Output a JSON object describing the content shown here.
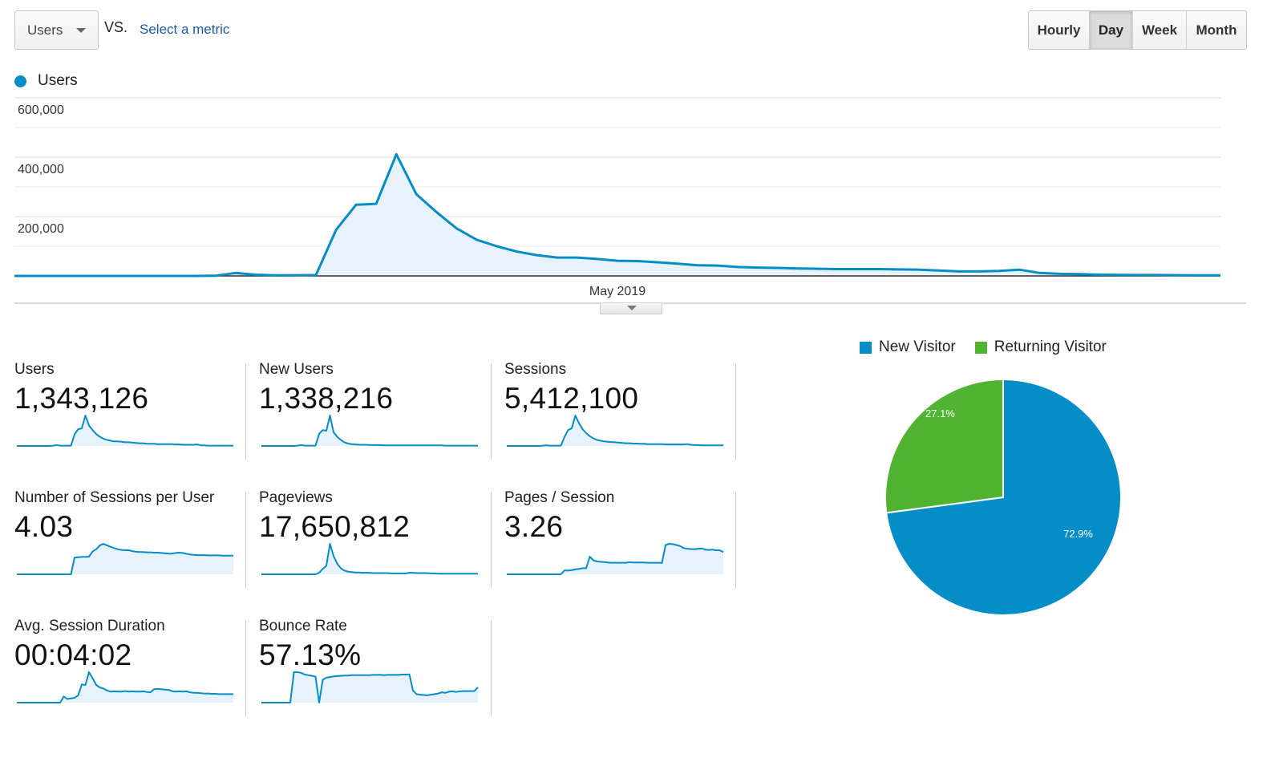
{
  "toolbar": {
    "metric_select": {
      "label": "Users",
      "icon": "caret-down-icon"
    },
    "vs_label": "VS.",
    "select_metric_link": "Select a metric",
    "granularity": [
      {
        "label": "Hourly",
        "active": false
      },
      {
        "label": "Day",
        "active": true
      },
      {
        "label": "Week",
        "active": false
      },
      {
        "label": "Month",
        "active": false
      }
    ]
  },
  "colors": {
    "primary": "#058dc7",
    "secondary": "#50b432",
    "area_fill": "#e8f2fa",
    "link": "#1a5ca8"
  },
  "chart_data": [
    {
      "type": "area",
      "title": "",
      "legend": [
        "Users"
      ],
      "legend_placement": "top-left",
      "xlabel": "",
      "ylabel": "",
      "x_tick_labels": [
        "May 2019"
      ],
      "y_tick_labels": [
        "600,000",
        "400,000",
        "200,000"
      ],
      "ylim": [
        0,
        600000
      ],
      "grid": true,
      "series": [
        {
          "name": "Users",
          "values": [
            0,
            0,
            0,
            0,
            0,
            0,
            0,
            0,
            0,
            0,
            500,
            10000,
            4000,
            2000,
            2500,
            3000,
            155000,
            240000,
            243000,
            410000,
            275000,
            215000,
            160000,
            122000,
            100000,
            82000,
            70000,
            62000,
            62000,
            57000,
            51000,
            50000,
            46000,
            41000,
            36000,
            35000,
            30000,
            28000,
            27000,
            25000,
            24000,
            23000,
            23000,
            23000,
            22000,
            21000,
            18000,
            15000,
            15000,
            17000,
            21000,
            10000,
            7000,
            6000,
            4000,
            3500,
            3000,
            3000,
            2500,
            2000,
            2000
          ]
        }
      ]
    },
    {
      "type": "pie",
      "title": "",
      "legend_placement": "top",
      "categories": [
        "New Visitor",
        "Returning Visitor"
      ],
      "values": [
        72.9,
        27.1
      ],
      "labels": [
        "72.9%",
        "27.1%"
      ],
      "colors": [
        "#058dc7",
        "#50b432"
      ]
    }
  ],
  "metrics": [
    {
      "label": "Users",
      "value": "1,343,126",
      "trend": [
        0,
        0,
        0,
        0,
        0,
        0,
        0,
        0,
        0,
        0,
        0.01,
        0.03,
        0.01,
        0.01,
        0.01,
        0.01,
        0.38,
        0.55,
        0.58,
        1.0,
        0.67,
        0.52,
        0.39,
        0.3,
        0.24,
        0.2,
        0.17,
        0.15,
        0.15,
        0.14,
        0.12,
        0.12,
        0.11,
        0.1,
        0.09,
        0.09,
        0.07,
        0.07,
        0.07,
        0.06,
        0.06,
        0.06,
        0.06,
        0.06,
        0.05,
        0.05,
        0.04,
        0.04,
        0.04,
        0.04,
        0.05,
        0.02,
        0.02,
        0.01,
        0.01,
        0.01,
        0.01,
        0.01,
        0.01,
        0.01,
        0.01
      ]
    },
    {
      "label": "New Users",
      "value": "1,338,216",
      "trend": [
        0,
        0,
        0,
        0,
        0,
        0,
        0,
        0,
        0,
        0,
        0.01,
        0.03,
        0.01,
        0.01,
        0.01,
        0.01,
        0.4,
        0.52,
        0.5,
        1.0,
        0.45,
        0.3,
        0.2,
        0.12,
        0.08,
        0.06,
        0.05,
        0.04,
        0.04,
        0.04,
        0.03,
        0.03,
        0.03,
        0.03,
        0.02,
        0.02,
        0.02,
        0.02,
        0.02,
        0.02,
        0.02,
        0.02,
        0.02,
        0.02,
        0.02,
        0.02,
        0.02,
        0.02,
        0.02,
        0.02,
        0.02,
        0.01,
        0.01,
        0.01,
        0.01,
        0.01,
        0.01,
        0.01,
        0.01,
        0.01,
        0.01
      ]
    },
    {
      "label": "Sessions",
      "value": "5,412,100",
      "trend": [
        0,
        0,
        0,
        0,
        0,
        0,
        0,
        0,
        0,
        0,
        0.01,
        0.02,
        0.01,
        0.01,
        0.01,
        0.01,
        0.3,
        0.52,
        0.58,
        1.0,
        0.75,
        0.55,
        0.42,
        0.32,
        0.25,
        0.2,
        0.17,
        0.15,
        0.14,
        0.13,
        0.12,
        0.11,
        0.1,
        0.09,
        0.09,
        0.08,
        0.08,
        0.07,
        0.07,
        0.06,
        0.06,
        0.06,
        0.06,
        0.06,
        0.05,
        0.05,
        0.05,
        0.05,
        0.05,
        0.05,
        0.06,
        0.04,
        0.03,
        0.03,
        0.02,
        0.02,
        0.02,
        0.02,
        0.02,
        0.02,
        0.02
      ]
    },
    {
      "label": "Number of Sessions per User",
      "value": "4.03",
      "trend": [
        0,
        0,
        0,
        0,
        0,
        0,
        0,
        0,
        0,
        0,
        0,
        0,
        0,
        0,
        0,
        0,
        0.55,
        0.56,
        0.57,
        0.57,
        0.58,
        0.75,
        0.82,
        0.95,
        1.0,
        0.95,
        0.9,
        0.86,
        0.82,
        0.8,
        0.79,
        0.79,
        0.76,
        0.74,
        0.73,
        0.73,
        0.72,
        0.72,
        0.71,
        0.71,
        0.7,
        0.69,
        0.68,
        0.68,
        0.7,
        0.71,
        0.7,
        0.67,
        0.65,
        0.64,
        0.63,
        0.63,
        0.63,
        0.62,
        0.62,
        0.62,
        0.62,
        0.61,
        0.61,
        0.61,
        0.61
      ]
    },
    {
      "label": "Pageviews",
      "value": "17,650,812",
      "trend": [
        0,
        0,
        0,
        0,
        0,
        0,
        0,
        0,
        0,
        0,
        0,
        0,
        0,
        0,
        0,
        0,
        0.05,
        0.18,
        0.28,
        1.0,
        0.6,
        0.35,
        0.2,
        0.12,
        0.09,
        0.07,
        0.06,
        0.06,
        0.05,
        0.05,
        0.05,
        0.04,
        0.04,
        0.04,
        0.04,
        0.04,
        0.03,
        0.03,
        0.03,
        0.03,
        0.03,
        0.05,
        0.05,
        0.04,
        0.04,
        0.04,
        0.04,
        0.03,
        0.03,
        0.02,
        0.02,
        0.02,
        0.02,
        0.02,
        0.02,
        0.02,
        0.02,
        0.02,
        0.02,
        0.02,
        0.02
      ]
    },
    {
      "label": "Pages / Session",
      "value": "3.26",
      "trend": [
        0,
        0,
        0,
        0,
        0,
        0,
        0,
        0,
        0,
        0,
        0,
        0,
        0,
        0,
        0,
        0,
        0.13,
        0.12,
        0.14,
        0.16,
        0.18,
        0.2,
        0.2,
        0.58,
        0.46,
        0.42,
        0.41,
        0.4,
        0.39,
        0.38,
        0.38,
        0.38,
        0.38,
        0.38,
        0.4,
        0.39,
        0.39,
        0.39,
        0.39,
        0.38,
        0.38,
        0.38,
        0.38,
        0.37,
        0.96,
        1.0,
        0.99,
        0.96,
        0.93,
        0.86,
        0.84,
        0.83,
        0.82,
        0.84,
        0.85,
        0.81,
        0.8,
        0.81,
        0.79,
        0.79,
        0.73
      ]
    },
    {
      "label": "Avg. Session Duration",
      "value": "00:04:02",
      "trend": [
        0,
        0,
        0,
        0,
        0,
        0,
        0,
        0,
        0,
        0,
        0,
        0,
        0,
        0.2,
        0.12,
        0.14,
        0.16,
        0.24,
        0.6,
        0.58,
        1.0,
        0.8,
        0.58,
        0.5,
        0.46,
        0.4,
        0.36,
        0.37,
        0.36,
        0.36,
        0.38,
        0.36,
        0.37,
        0.36,
        0.36,
        0.37,
        0.35,
        0.34,
        0.44,
        0.45,
        0.44,
        0.43,
        0.42,
        0.38,
        0.36,
        0.37,
        0.36,
        0.37,
        0.34,
        0.32,
        0.32,
        0.31,
        0.3,
        0.3,
        0.29,
        0.29,
        0.28,
        0.28,
        0.28,
        0.28,
        0.28
      ]
    },
    {
      "label": "Bounce Rate",
      "value": "57.13%",
      "trend": [
        0,
        0,
        0,
        0,
        0,
        0,
        0,
        0,
        0,
        1.0,
        1.0,
        0.98,
        0.92,
        0.9,
        0.88,
        0.85,
        0.0,
        0.75,
        0.82,
        0.84,
        0.86,
        0.87,
        0.88,
        0.89,
        0.89,
        0.9,
        0.9,
        0.9,
        0.9,
        0.9,
        0.9,
        0.91,
        0.91,
        0.91,
        0.9,
        0.91,
        0.91,
        0.91,
        0.91,
        0.92,
        0.92,
        0.93,
        0.4,
        0.28,
        0.26,
        0.25,
        0.24,
        0.26,
        0.28,
        0.3,
        0.34,
        0.32,
        0.36,
        0.37,
        0.35,
        0.37,
        0.38,
        0.38,
        0.38,
        0.38,
        0.5
      ]
    }
  ]
}
